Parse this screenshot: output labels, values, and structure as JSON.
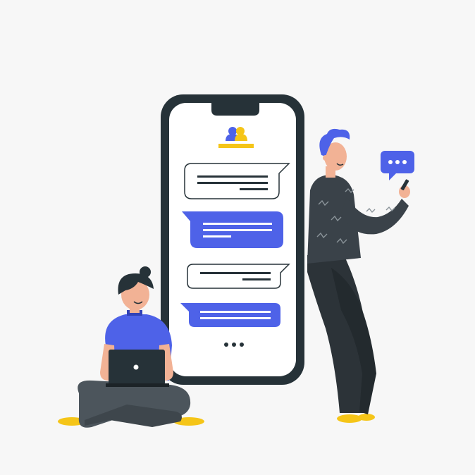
{
  "colors": {
    "background": "#f7f7f7",
    "phone_frame": "#263238",
    "phone_screen": "#ffffff",
    "accent_blue": "#4e62e8",
    "accent_yellow": "#f5c518",
    "skin": "#f2b295",
    "dark_clothing": "#2c3338",
    "sweater": "#3a4249",
    "pants_grey": "#4c555c",
    "hair_dark": "#263238"
  },
  "icons": {
    "contacts": "users-icon",
    "typing": "ellipsis-icon",
    "speech": "speech-bubble-icon",
    "laptop": "laptop-icon"
  },
  "chat": {
    "incoming_count_shown": 2,
    "outgoing_count_shown": 2
  }
}
